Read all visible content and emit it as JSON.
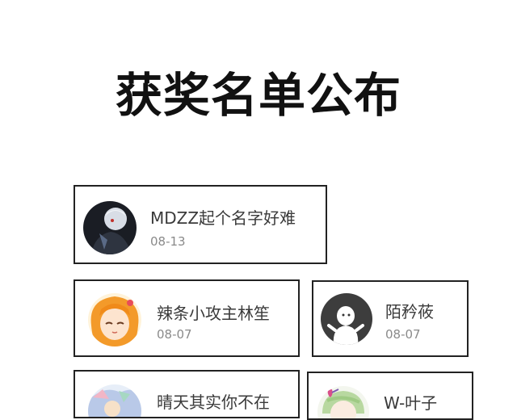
{
  "title": "获奖名单公布",
  "winners": [
    {
      "name": "MDZZ起个名字好难",
      "date": "08-13",
      "avatar": "dark-anime-character-avatar"
    },
    {
      "name": "辣条小攻主林笙",
      "date": "08-07",
      "avatar": "orange-hair-anime-girl-avatar"
    },
    {
      "name": "陌矜莜",
      "date": "08-07",
      "avatar": "default-ghost-avatar"
    },
    {
      "name": "晴天其实你不在",
      "date": "",
      "avatar": "colorful-anime-avatar"
    },
    {
      "name": "W-叶子",
      "date": "",
      "avatar": "green-hair-anime-avatar"
    }
  ]
}
